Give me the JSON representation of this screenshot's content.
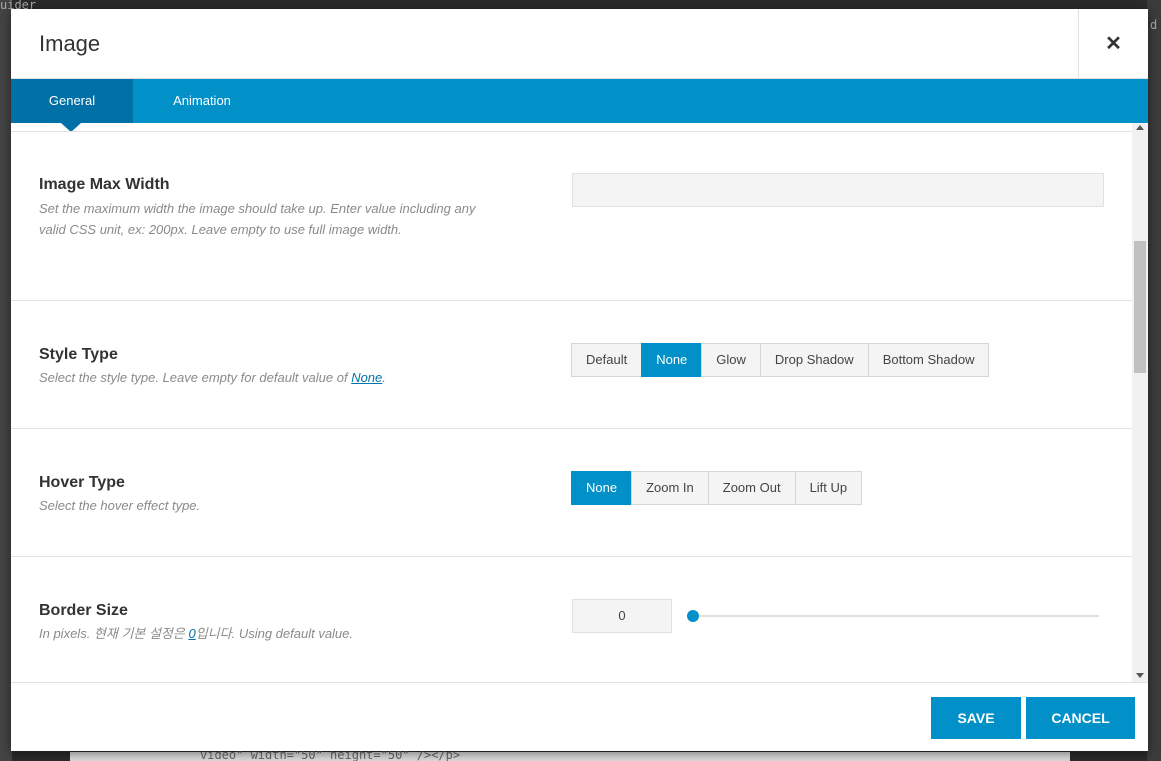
{
  "background": {
    "fragments": [
      "uider",
      "d",
      "video\" width=\"50\" height=\"50\" /></p>"
    ]
  },
  "modal": {
    "title": "Image",
    "close_icon": "close-icon"
  },
  "tabs": [
    {
      "label": "General",
      "active": true
    },
    {
      "label": "Animation",
      "active": false
    }
  ],
  "fields": {
    "image_max_width": {
      "label": "Image Max Width",
      "description": "Set the maximum width the image should take up. Enter value including any valid CSS unit, ex: 200px. Leave empty to use full image width.",
      "value": ""
    },
    "style_type": {
      "label": "Style Type",
      "description_prefix": "Select the style type. Leave empty for default value of ",
      "description_link": "None",
      "description_suffix": ".",
      "options": [
        "Default",
        "None",
        "Glow",
        "Drop Shadow",
        "Bottom Shadow"
      ],
      "selected": "None"
    },
    "hover_type": {
      "label": "Hover Type",
      "description": "Select the hover effect type.",
      "options": [
        "None",
        "Zoom In",
        "Zoom Out",
        "Lift Up"
      ],
      "selected": "None"
    },
    "border_size": {
      "label": "Border Size",
      "description_prefix": "In pixels. 현재 기본 설정은 ",
      "description_link": "0",
      "description_suffix": "입니다. Using default value.",
      "value": "0",
      "slider_fraction": 0
    }
  },
  "footer": {
    "save_label": "SAVE",
    "cancel_label": "CANCEL"
  },
  "colors": {
    "accent": "#0190c8",
    "accent_dark": "#0170a6"
  }
}
